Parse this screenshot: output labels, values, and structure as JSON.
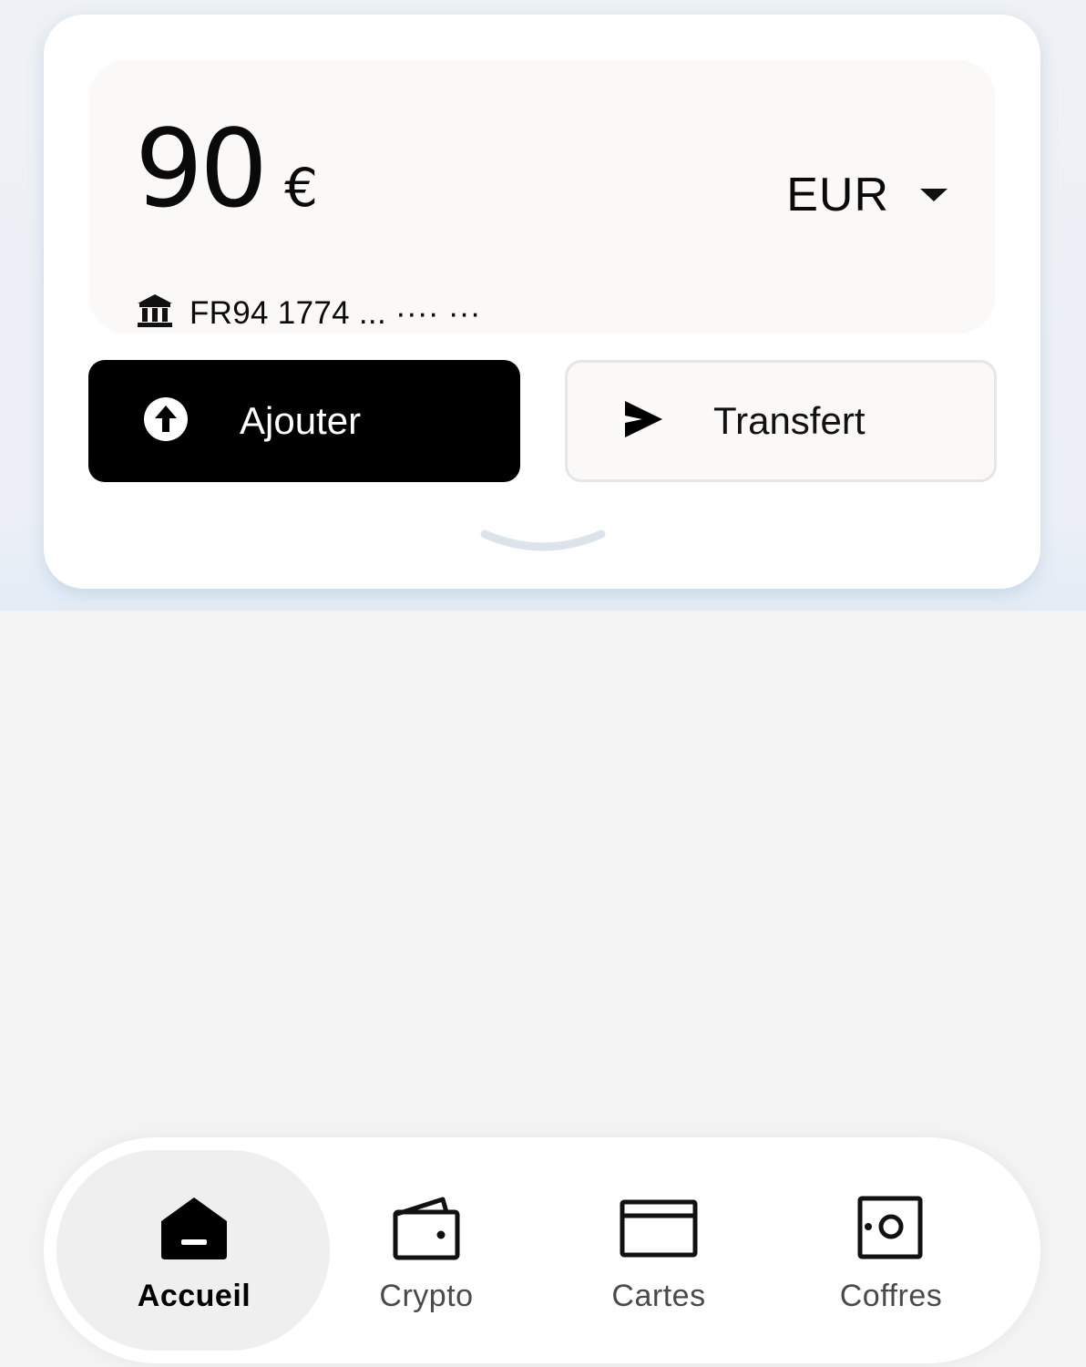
{
  "account": {
    "balance_amount": "90",
    "balance_currency_symbol": "€",
    "currency_code": "EUR",
    "iban_masked": "FR94 1774 ... ···· ···"
  },
  "actions": {
    "add_label": "Ajouter",
    "transfer_label": "Transfert"
  },
  "nav": {
    "items": [
      {
        "label": "Accueil",
        "icon": "home-icon",
        "active": true
      },
      {
        "label": "Crypto",
        "icon": "wallet-icon",
        "active": false
      },
      {
        "label": "Cartes",
        "icon": "card-icon",
        "active": false
      },
      {
        "label": "Coffres",
        "icon": "safe-icon",
        "active": false
      }
    ]
  },
  "colors": {
    "primary_button": "#000000",
    "card_background": "#ffffff",
    "page_background": "#f3f3f3"
  }
}
